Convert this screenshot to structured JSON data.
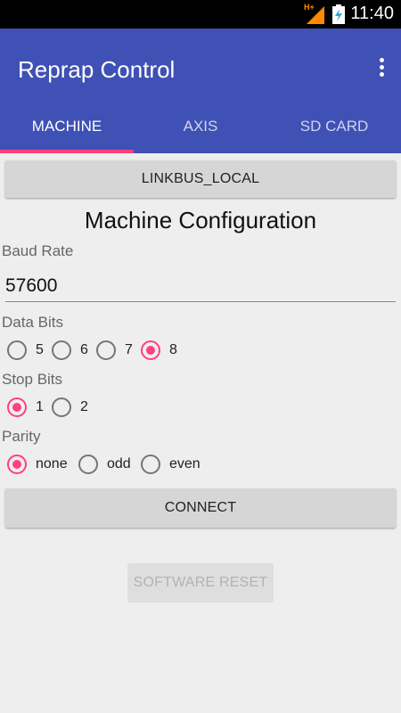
{
  "status_bar": {
    "network": "H+",
    "time": "11:40"
  },
  "app_bar": {
    "title": "Reprap Control"
  },
  "tabs": [
    {
      "label": "MACHINE",
      "selected": true
    },
    {
      "label": "AXIS",
      "selected": false
    },
    {
      "label": "SD CARD",
      "selected": false
    }
  ],
  "device_button": "LINKBUS_LOCAL",
  "heading": "Machine Configuration",
  "baud": {
    "label": "Baud Rate",
    "value": "57600"
  },
  "data_bits": {
    "label": "Data Bits",
    "options": [
      "5",
      "6",
      "7",
      "8"
    ],
    "selected": "8"
  },
  "stop_bits": {
    "label": "Stop Bits",
    "options": [
      "1",
      "2"
    ],
    "selected": "1"
  },
  "parity": {
    "label": "Parity",
    "options": [
      "none",
      "odd",
      "even"
    ],
    "selected": "none"
  },
  "connect_button": "CONNECT",
  "reset_button": "SOFTWARE RESET",
  "colors": {
    "primary": "#3f51b5",
    "accent": "#ff4081",
    "background": "#eeeeee"
  }
}
